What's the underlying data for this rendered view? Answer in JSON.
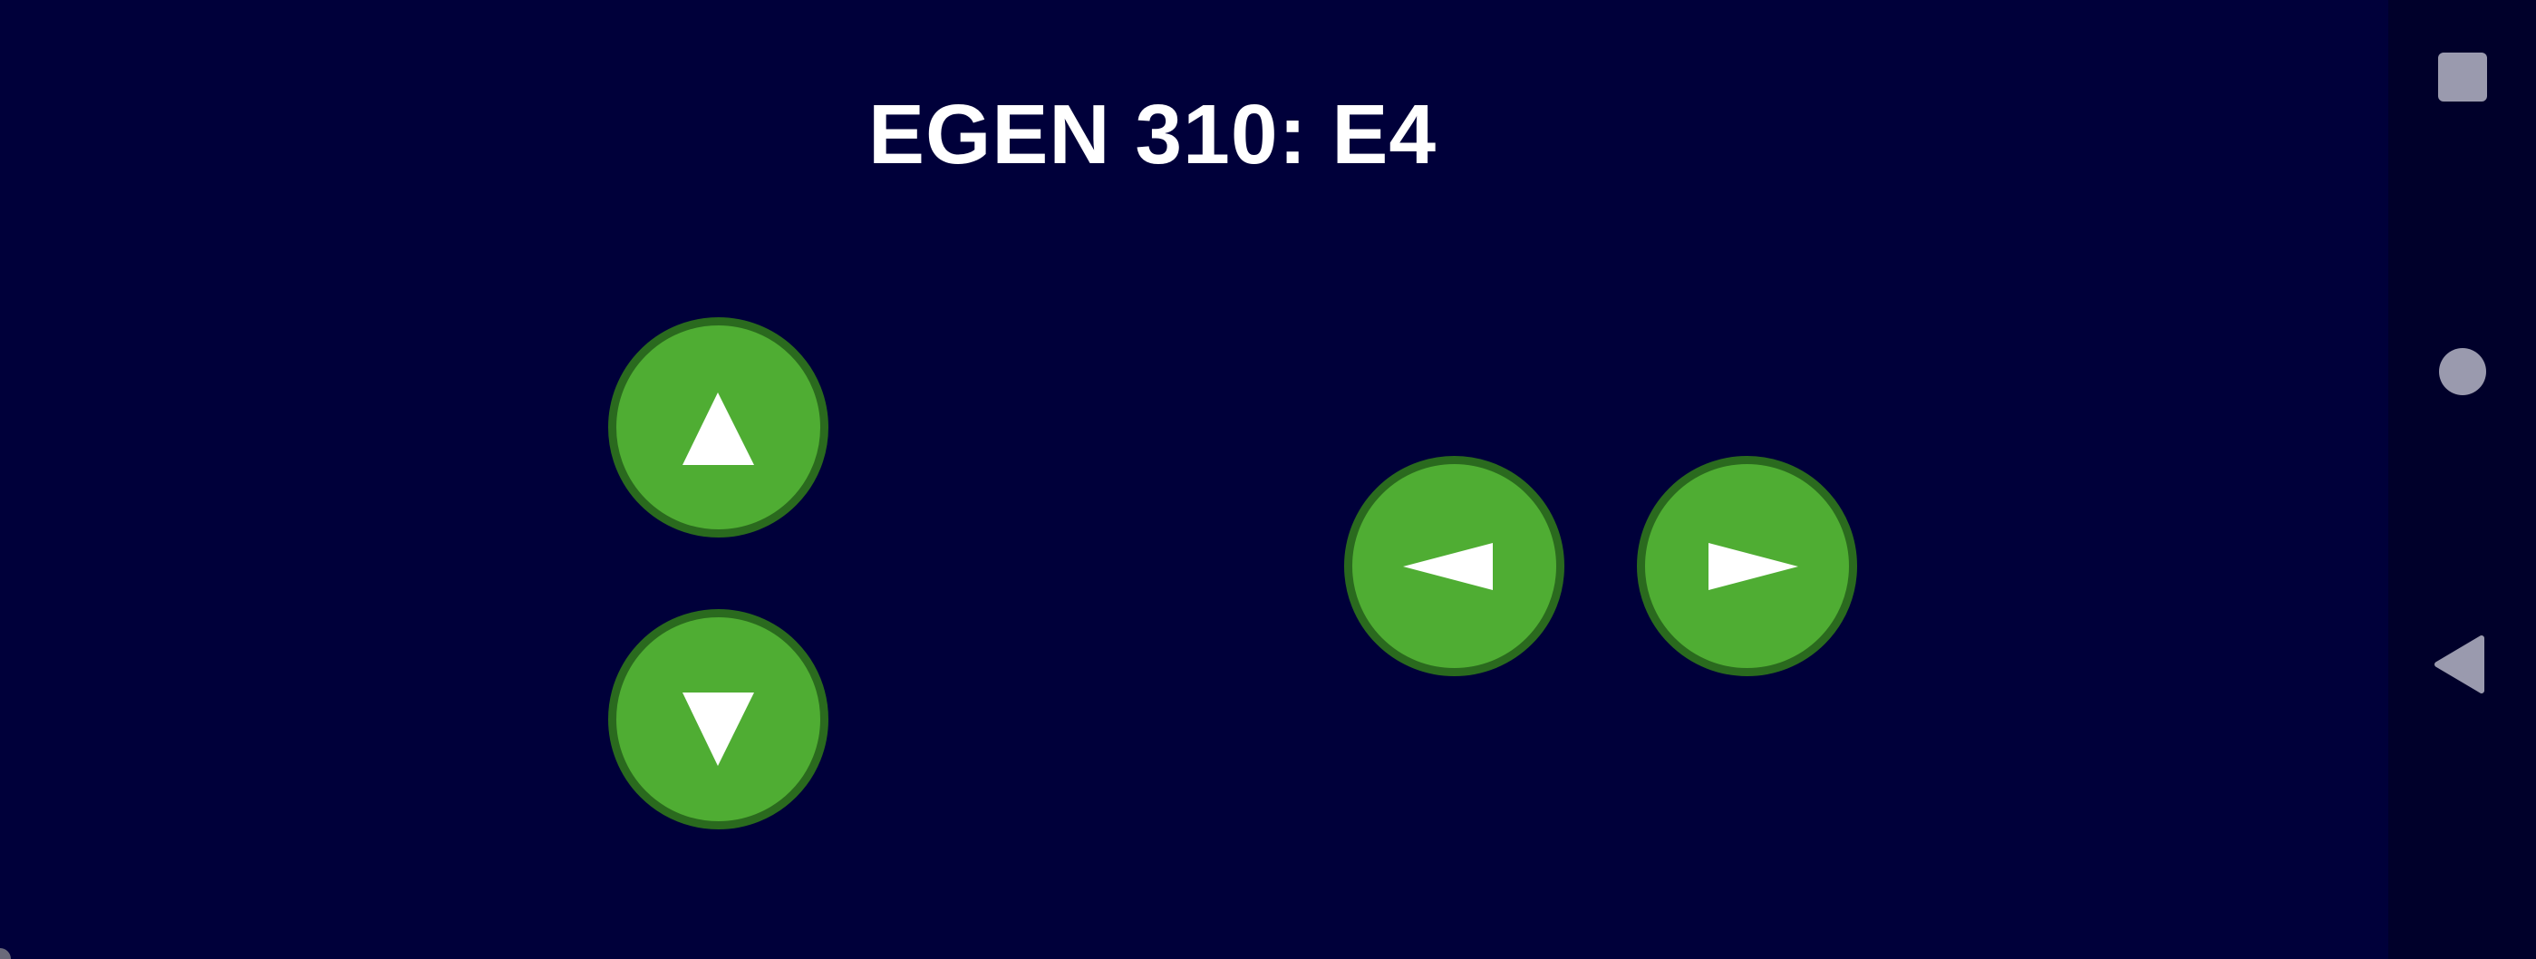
{
  "app": {
    "title": "EGEN 310: E4"
  },
  "controls": {
    "forward": {
      "icon": "arrow-up-icon"
    },
    "backward": {
      "icon": "arrow-down-icon"
    },
    "turn_left": {
      "icon": "arrow-left-icon"
    },
    "turn_right": {
      "icon": "arrow-right-icon"
    },
    "colors": {
      "button_fill": "#4fad33",
      "button_border": "#2a6a1e",
      "arrow": "#ffffff",
      "background": "#00003a"
    }
  },
  "system_nav": {
    "recents_icon": "square-icon",
    "home_icon": "circle-icon",
    "back_icon": "triangle-back-icon",
    "icon_color": "#9a9aae"
  }
}
